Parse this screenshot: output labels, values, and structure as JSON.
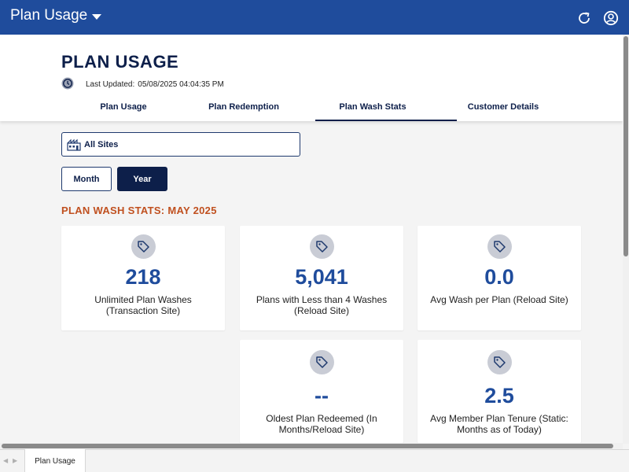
{
  "topbar": {
    "title": "Plan Usage",
    "icons": [
      "refresh-icon",
      "account-icon"
    ],
    "color": "#1f4c9c"
  },
  "header": {
    "page_title": "PLAN USAGE",
    "last_updated_label": "Last Updated:",
    "last_updated_value": "05/08/2025 04:04:35 PM"
  },
  "tabs": [
    {
      "label": "Plan Usage",
      "active": false
    },
    {
      "label": "Plan Redemption",
      "active": false
    },
    {
      "label": "Plan Wash Stats",
      "active": true
    },
    {
      "label": "Customer Details",
      "active": false
    }
  ],
  "filters": {
    "site_label": "All Sites",
    "month_label": "Month",
    "year_label": "Year",
    "selected_period": "Year"
  },
  "section": {
    "title": "PLAN WASH STATS: MAY 2025",
    "title_color": "#c0501f"
  },
  "cards": [
    {
      "value": "218",
      "label": "Unlimited Plan Washes (Transaction Site)"
    },
    {
      "value": "5,041",
      "label": "Plans with Less than 4 Washes (Reload Site)"
    },
    {
      "value": "0.0",
      "label": "Avg Wash per Plan (Reload Site)"
    },
    {
      "value": "--",
      "label": "Oldest Plan Redeemed (In Months/Reload Site)"
    },
    {
      "value": "2.5",
      "label": "Avg Member Plan Tenure (Static: Months as of Today)"
    }
  ],
  "sheet_tabs": [
    "Plan Usage"
  ]
}
